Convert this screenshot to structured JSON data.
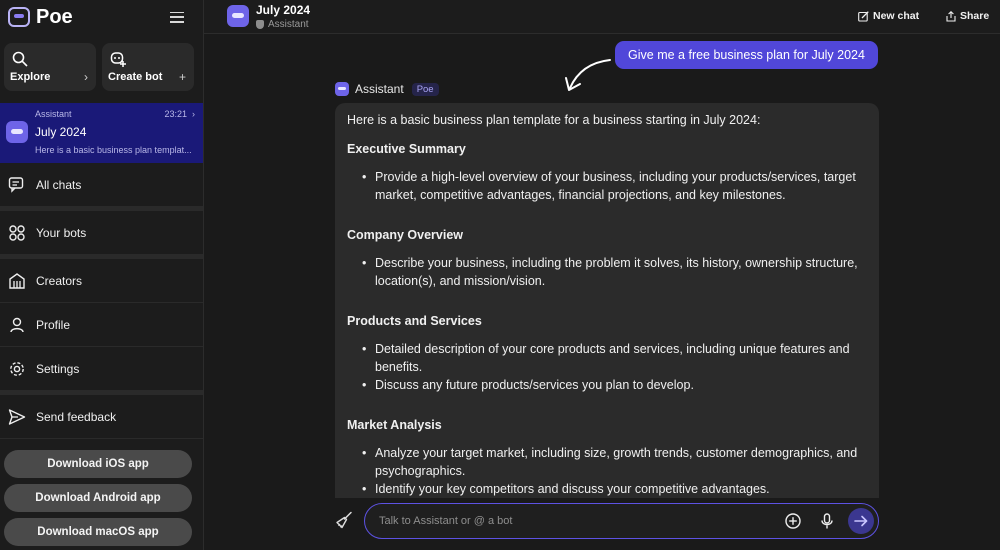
{
  "app": {
    "name": "Poe"
  },
  "sidebar": {
    "explore_label": "Explore",
    "create_bot_label": "Create bot",
    "active_chat": {
      "bot_label": "Assistant",
      "time": "23:21",
      "title": "July 2024",
      "snippet": "Here is a basic business plan templat..."
    },
    "nav": {
      "all_chats": "All chats",
      "your_bots": "Your bots",
      "creators": "Creators",
      "profile": "Profile",
      "settings": "Settings",
      "send_feedback": "Send feedback"
    },
    "downloads": {
      "ios": "Download iOS app",
      "android": "Download Android app",
      "macos": "Download macOS app"
    }
  },
  "header": {
    "title": "July 2024",
    "subtitle": "Assistant",
    "new_chat": "New chat",
    "share": "Share"
  },
  "conversation": {
    "user_message": "Give me a free business plan for July 2024",
    "bot_name": "Assistant",
    "bot_tag": "Poe",
    "intro": "Here is a basic business plan template for a business starting in July 2024:",
    "sections": [
      {
        "heading": "Executive Summary",
        "bullets": [
          "Provide a high-level overview of your business, including your products/services, target market, competitive advantages, financial projections, and key milestones."
        ]
      },
      {
        "heading": "Company Overview",
        "bullets": [
          "Describe your business, including the problem it solves, its history, ownership structure, location(s), and mission/vision."
        ]
      },
      {
        "heading": "Products and Services",
        "bullets": [
          "Detailed description of your core products and services, including unique features and benefits.",
          "Discuss any future products/services you plan to develop."
        ]
      },
      {
        "heading": "Market Analysis",
        "bullets": [
          "Analyze your target market, including size, growth trends, customer demographics, and psychographics.",
          "Identify your key competitors and discuss your competitive advantages."
        ]
      }
    ]
  },
  "composer": {
    "placeholder": "Talk to Assistant or @ a bot"
  },
  "colors": {
    "accent": "#5147d9",
    "active_chat_bg": "#1a1978",
    "background": "#1a1a1a"
  }
}
